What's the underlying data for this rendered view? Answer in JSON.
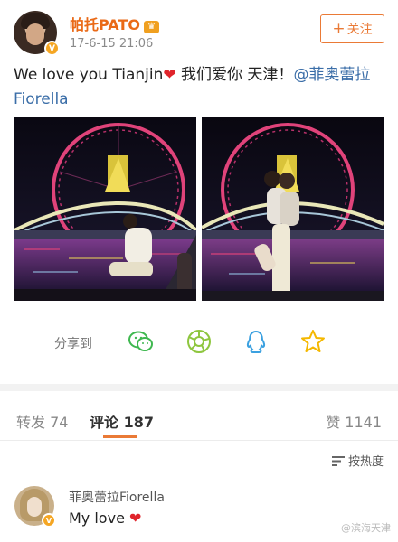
{
  "post": {
    "username": "帕托PATO",
    "crown": "♛",
    "badge": "V",
    "time": "17-6-15 21:06",
    "follow_plus": "+",
    "follow_label": "关注",
    "text_part1": "We love you Tianjin",
    "heart": "❤",
    "text_part2": " 我们爱你 天津！",
    "mention": "@菲奥蕾拉Fiorella"
  },
  "photos": [
    {
      "name": "photo-couple-sitting-ferris-wheel"
    },
    {
      "name": "photo-couple-kissing-ferris-wheel"
    }
  ],
  "share": {
    "label": "分享到",
    "icons": [
      "wechat-icon",
      "moments-icon",
      "qq-icon",
      "qzone-icon"
    ],
    "colors": {
      "wechat": "#3fb850",
      "moments": "#8ec63f",
      "qq": "#3aa0e0",
      "qzone": "#f5b800"
    }
  },
  "tabs": {
    "repost": "转发 74",
    "comments": "评论 187",
    "likes": "赞 1141"
  },
  "sort": {
    "label": "按热度"
  },
  "comment": {
    "badge": "V",
    "username": "菲奥蕾拉Fiorella",
    "text": "My love",
    "heart": "❤"
  },
  "watermark": "@滨海天津",
  "colors": {
    "accent": "#ea7a36",
    "username": "#ea6a17",
    "link": "#3b6ea8",
    "heart": "#e0242b"
  }
}
